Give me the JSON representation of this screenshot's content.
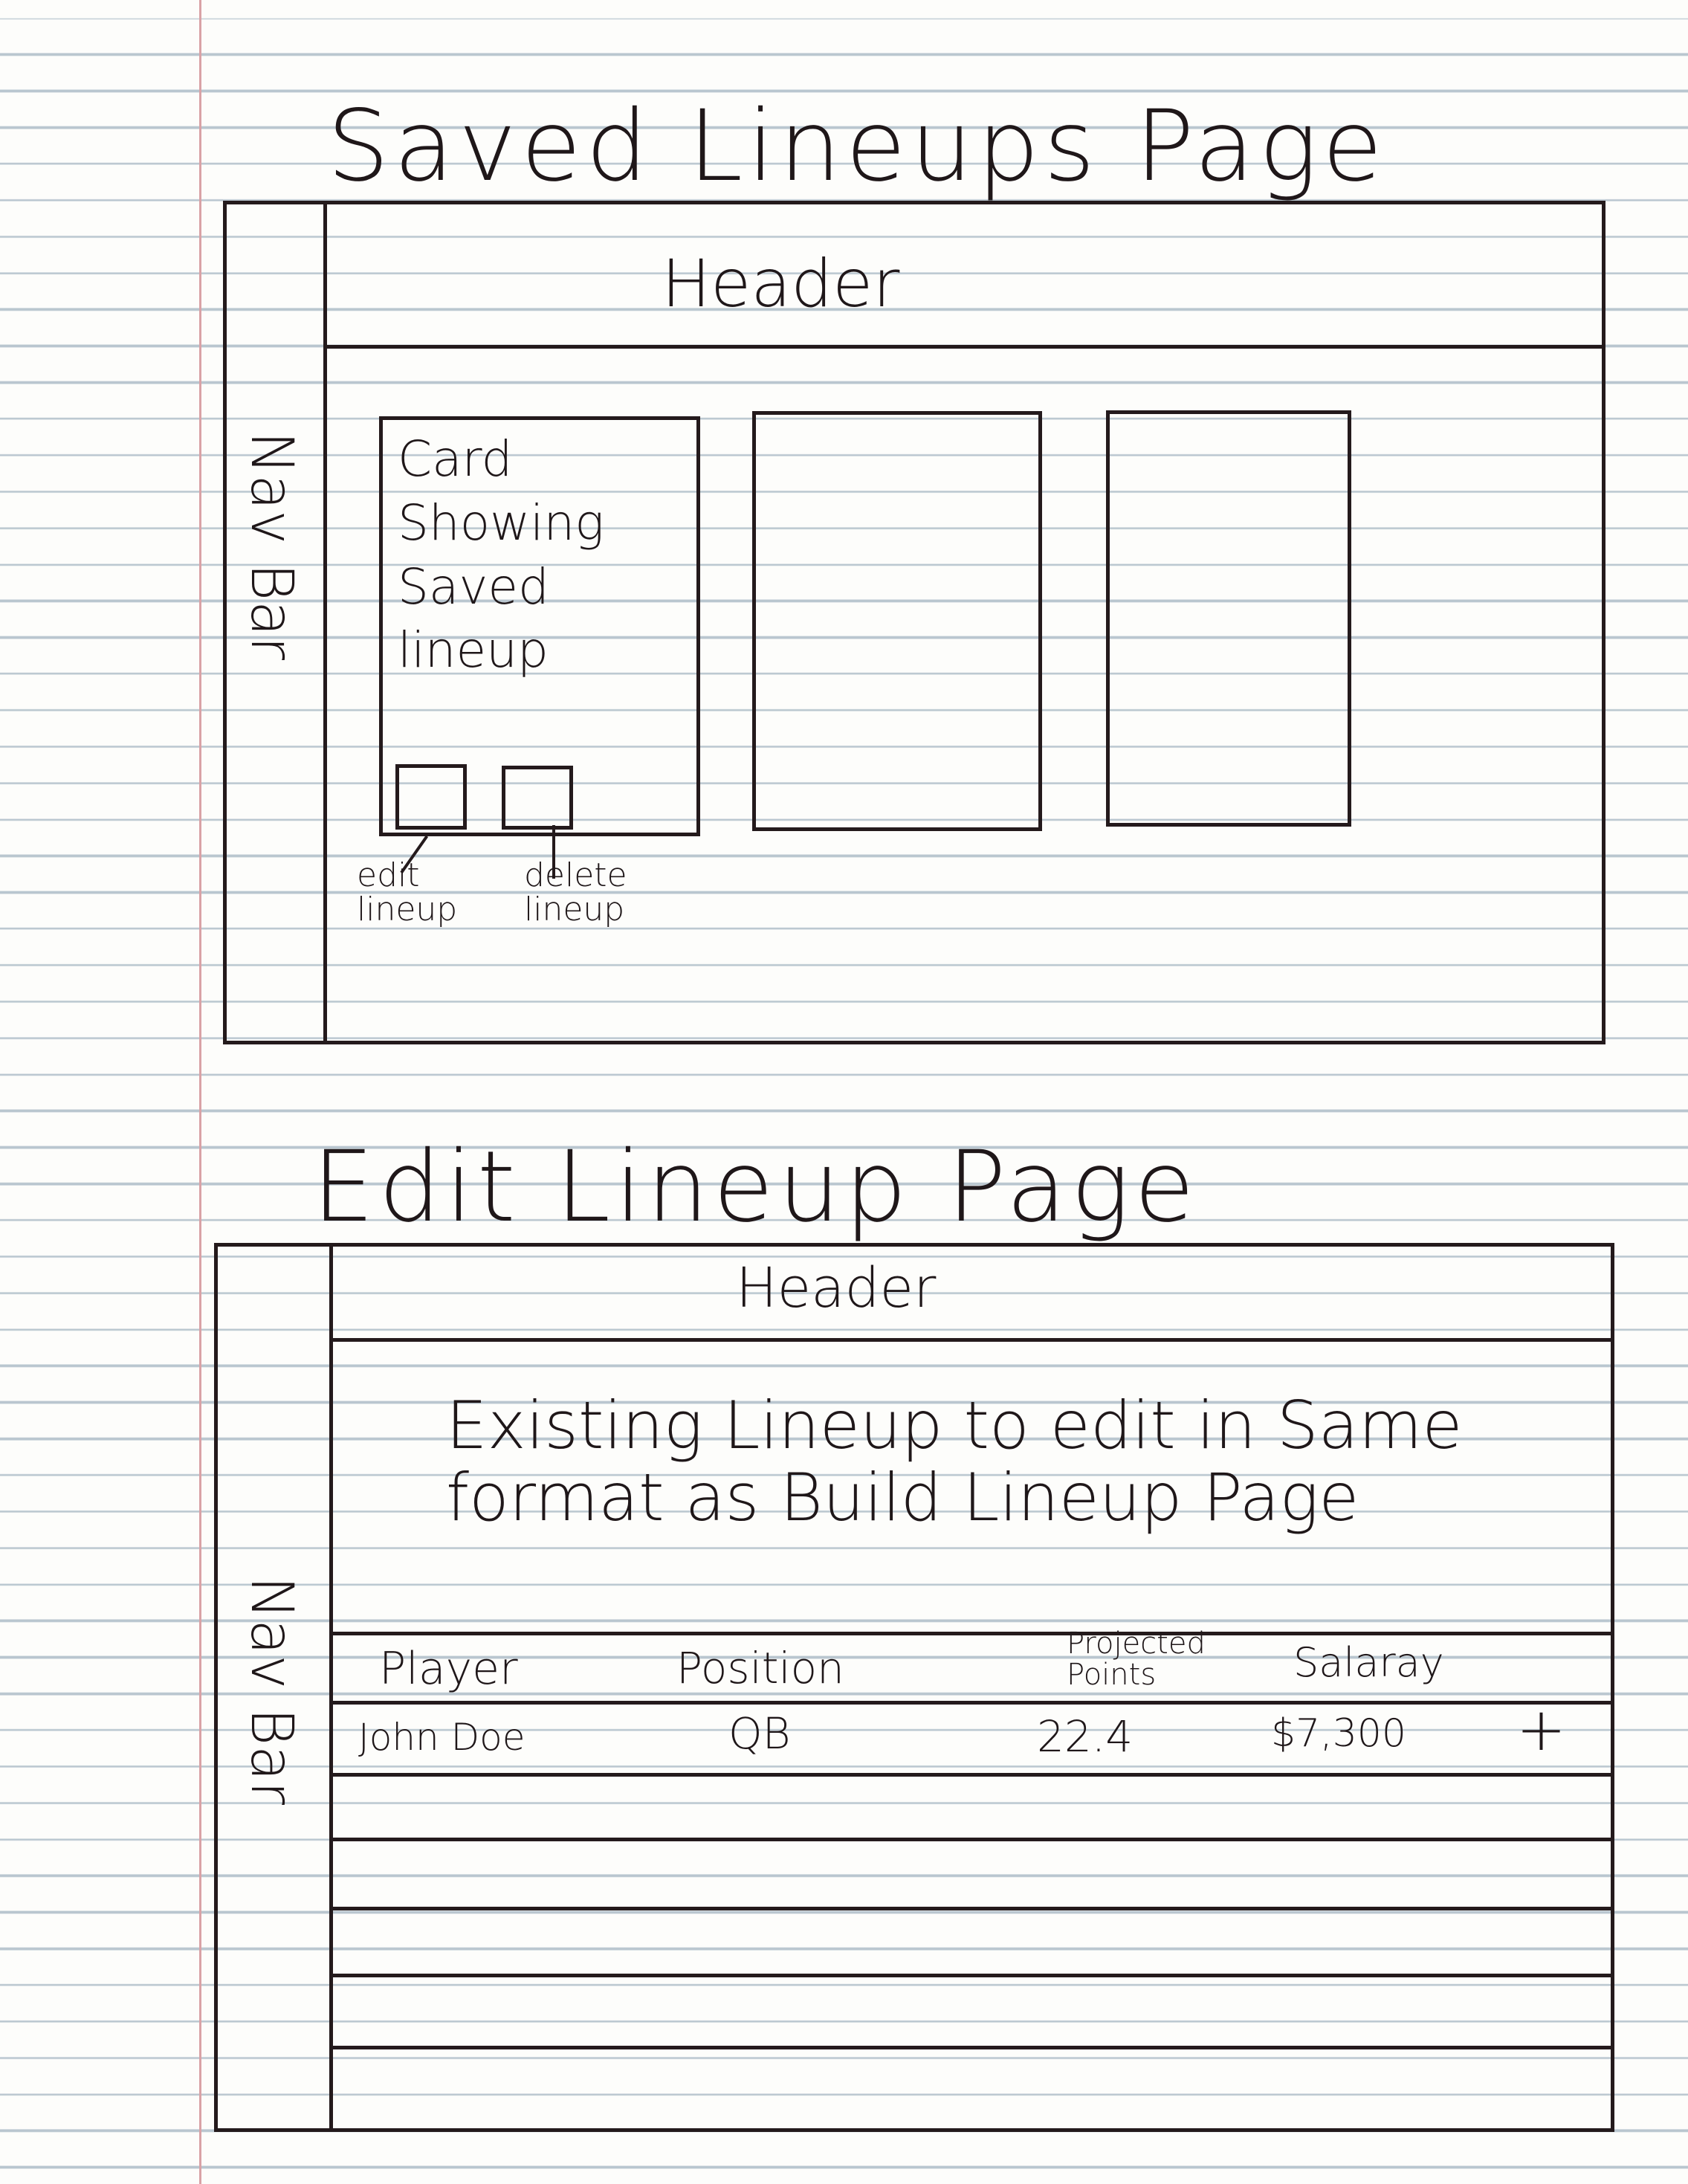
{
  "saved_page": {
    "title": "Saved Lineups Page",
    "header": "Header",
    "nav": "Nav Bar",
    "card_text": "Card Showing Saved lineup",
    "edit_label": "edit lineup",
    "delete_label": "delete lineup"
  },
  "edit_page": {
    "title": "Edit Lineup Page",
    "header": "Header",
    "nav": "Nav Bar",
    "description": "Existing Lineup to edit in Same format as Build Lineup Page",
    "columns": {
      "player": "Player",
      "position": "Position",
      "projected": "Projected Points",
      "salary": "Salaray"
    },
    "rows": [
      {
        "player": "John Doe",
        "position": "QB",
        "projected": "22.4",
        "salary": "$7,300",
        "action": "+"
      }
    ]
  }
}
